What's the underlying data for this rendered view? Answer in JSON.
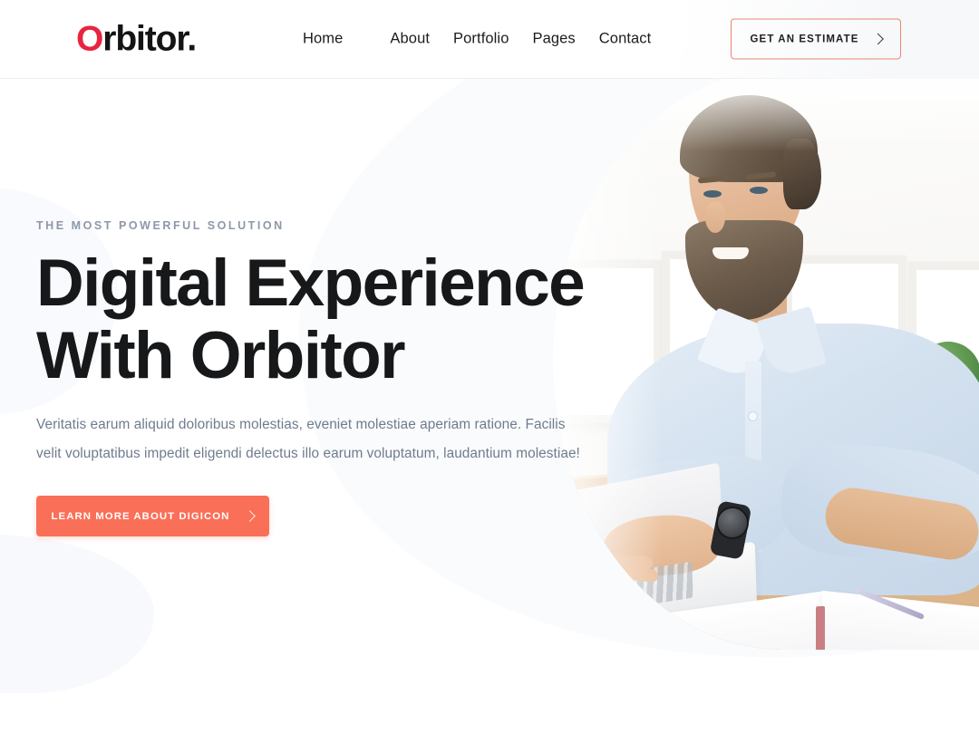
{
  "brand": {
    "initial": "O",
    "rest": "rbitor.",
    "accent_color": "#e8243f"
  },
  "header": {
    "nav": [
      {
        "label": "Home"
      },
      {
        "label": "About"
      },
      {
        "label": "Portfolio"
      },
      {
        "label": "Pages"
      },
      {
        "label": "Contact"
      }
    ],
    "cta": {
      "label": "GET AN ESTIMATE",
      "icon": "chevron-right-icon",
      "border_color": "#e8866f"
    }
  },
  "hero": {
    "eyebrow": "THE MOST POWERFUL SOLUTION",
    "headline_line1": "Digital Experience",
    "headline_line2": "With Orbitor",
    "lead": "Veritatis earum aliquid doloribus molestias, eveniet molestiae aperiam ratione. Facilis velit voluptatibus impedit eligendi delectus illo earum voluptatum, laudantium molestiae!",
    "cta": {
      "label": "LEARN MORE ABOUT DIGICON",
      "icon": "chevron-right-icon",
      "background_color": "#fa6f57"
    },
    "image_alt": "Smiling bearded man in light blue shirt typing on a laptop at a wooden desk with an open notebook"
  },
  "colors": {
    "accent_coral": "#fa6f57",
    "brand_red": "#e8243f",
    "heading": "#17181a",
    "body_text": "#6f7c8e",
    "eyebrow": "#8c98aa",
    "page_background": "#ffffff"
  }
}
